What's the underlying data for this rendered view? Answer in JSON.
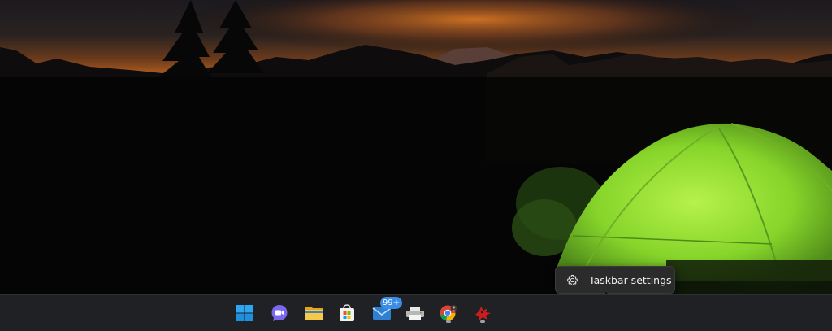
{
  "desktop": {
    "wallpaper": "night-sky-mountains-with-glowing-green-tent"
  },
  "context_menu": {
    "items": [
      {
        "label": "Taskbar settings",
        "icon": "gear-icon"
      }
    ]
  },
  "taskbar": {
    "background": "#202124",
    "icons": [
      {
        "name": "start-button",
        "icon": "windows-logo-icon",
        "running": false
      },
      {
        "name": "teams-chat-button",
        "icon": "video-chat-icon",
        "running": false
      },
      {
        "name": "file-explorer-button",
        "icon": "folder-icon",
        "running": false
      },
      {
        "name": "microsoft-store-button",
        "icon": "store-bag-icon",
        "running": false
      },
      {
        "name": "mail-button",
        "icon": "mail-icon",
        "running": false,
        "badge": "99+"
      },
      {
        "name": "printer-button",
        "icon": "printer-icon",
        "running": false
      },
      {
        "name": "chrome-button",
        "icon": "chrome-icon",
        "running": true
      },
      {
        "name": "red-app-button",
        "icon": "red-bird-icon",
        "running": true
      }
    ]
  },
  "colors": {
    "tent_green": "#9be33a",
    "sunset_orange": "#c8621e",
    "accent_blue": "#3a8ee6"
  }
}
